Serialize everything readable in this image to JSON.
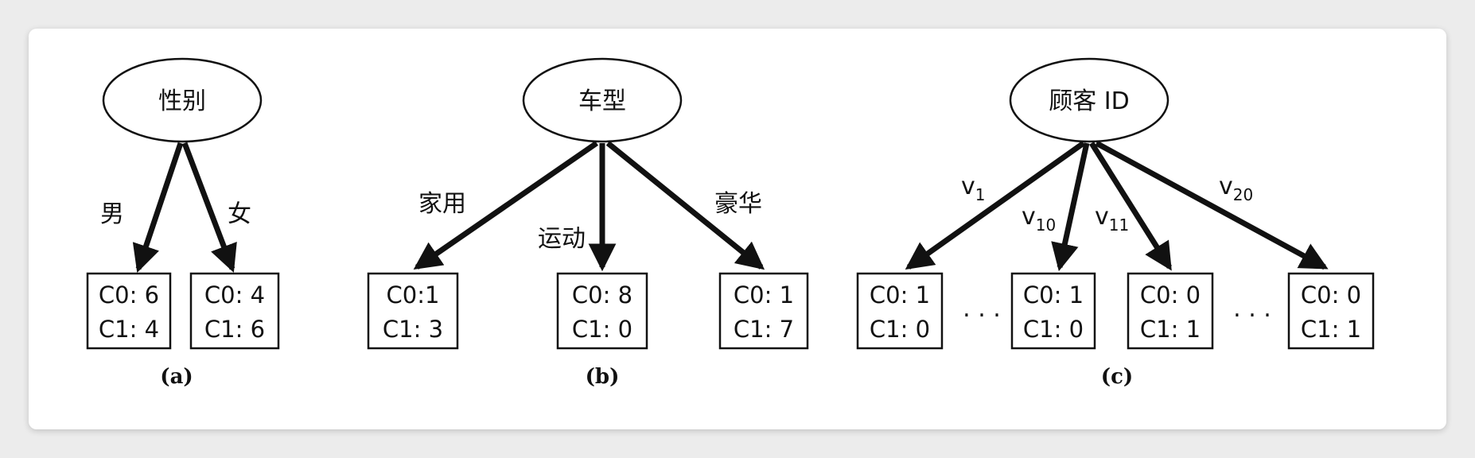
{
  "diagrams": [
    {
      "caption": "(a)",
      "root": "性别",
      "children": [
        {
          "edge": "男",
          "c0": "C0: 6",
          "c1": "C1: 4"
        },
        {
          "edge": "女",
          "c0": "C0: 4",
          "c1": "C1: 6"
        }
      ]
    },
    {
      "caption": "(b)",
      "root": "车型",
      "children": [
        {
          "edge": "家用",
          "c0": "C0:1",
          "c1": "C1: 3"
        },
        {
          "edge": "运动",
          "c0": "C0: 8",
          "c1": "C1: 0"
        },
        {
          "edge": "豪华",
          "c0": "C0: 1",
          "c1": "C1: 7"
        }
      ]
    },
    {
      "caption": "(c)",
      "root": "顾客 ID",
      "children": [
        {
          "edge_base": "v",
          "edge_sub": "1",
          "c0": "C0: 1",
          "c1": "C1: 0"
        },
        {
          "edge_base": "v",
          "edge_sub": "10",
          "c0": "C0: 1",
          "c1": "C1: 0"
        },
        {
          "edge_base": "v",
          "edge_sub": "11",
          "c0": "C0: 0",
          "c1": "C1: 1"
        },
        {
          "edge_base": "v",
          "edge_sub": "20",
          "c0": "C0: 0",
          "c1": "C1: 1"
        }
      ],
      "ellipsis": ". . .",
      "ellipsis2": ". . ."
    }
  ]
}
